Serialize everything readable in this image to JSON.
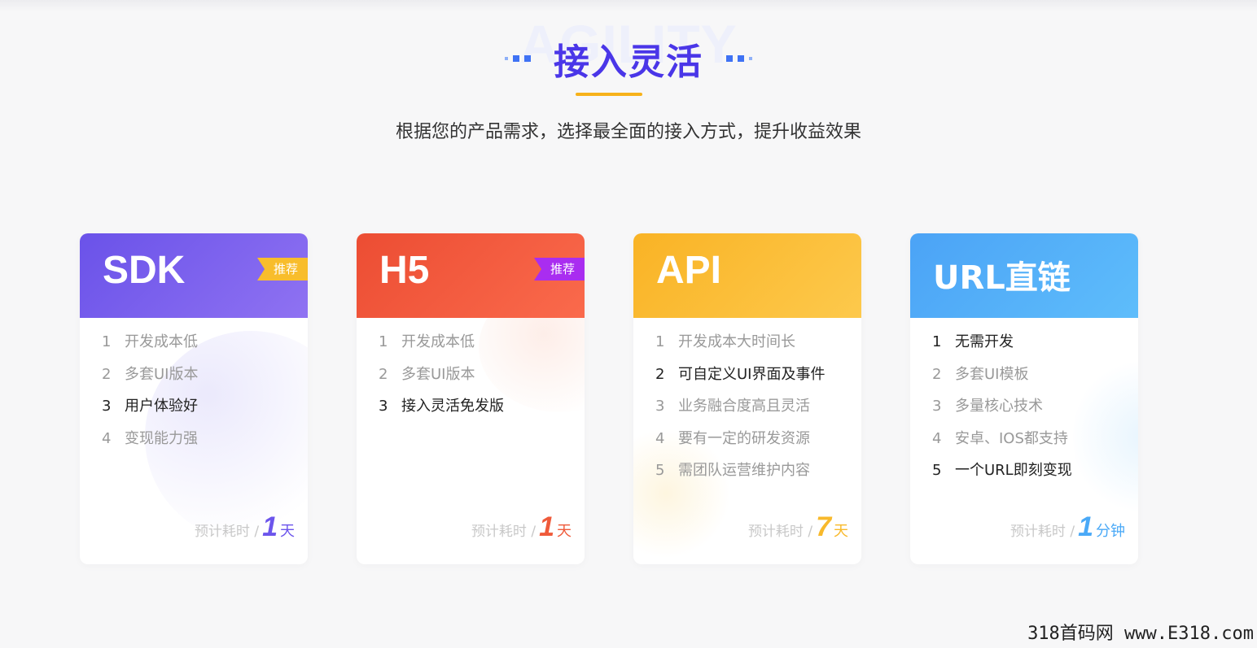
{
  "section": {
    "bg_word": "AGILITY",
    "title": "接入灵活",
    "subtitle": "根据您的产品需求，选择最全面的接入方式，提升收益效果"
  },
  "colors": {
    "title": "#4a36e8",
    "underline": "#f7b21b",
    "dots": "#3f72f4"
  },
  "cards": [
    {
      "name": "SDK",
      "badge": "推荐",
      "features": [
        {
          "n": "1",
          "text": "开发成本低",
          "highlight": false
        },
        {
          "n": "2",
          "text": "多套UI版本",
          "highlight": false
        },
        {
          "n": "3",
          "text": "用户体验好",
          "highlight": true
        },
        {
          "n": "4",
          "text": "变现能力强",
          "highlight": false
        }
      ],
      "est_label": "预计耗时 /",
      "est_value": "1",
      "est_unit": "天",
      "accent": "#6c55ec"
    },
    {
      "name": "H5",
      "badge": "推荐",
      "features": [
        {
          "n": "1",
          "text": "开发成本低",
          "highlight": false
        },
        {
          "n": "2",
          "text": "多套UI版本",
          "highlight": false
        },
        {
          "n": "3",
          "text": "接入灵活免发版",
          "highlight": true
        }
      ],
      "est_label": "预计耗时 /",
      "est_value": "1",
      "est_unit": "天",
      "accent": "#ef5a3a"
    },
    {
      "name": "API",
      "badge": "",
      "features": [
        {
          "n": "1",
          "text": "开发成本大时间长",
          "highlight": false
        },
        {
          "n": "2",
          "text": "可自定义UI界面及事件",
          "highlight": true
        },
        {
          "n": "3",
          "text": "业务融合度高且灵活",
          "highlight": false
        },
        {
          "n": "4",
          "text": "要有一定的研发资源",
          "highlight": false
        },
        {
          "n": "5",
          "text": "需团队运营维护内容",
          "highlight": false
        }
      ],
      "est_label": "预计耗时 /",
      "est_value": "7",
      "est_unit": "天",
      "accent": "#f8b92b"
    },
    {
      "name": "URL直链",
      "badge": "",
      "features": [
        {
          "n": "1",
          "text": "无需开发",
          "highlight": true
        },
        {
          "n": "2",
          "text": "多套UI模板",
          "highlight": false
        },
        {
          "n": "3",
          "text": "多量核心技术",
          "highlight": false
        },
        {
          "n": "4",
          "text": "安卓、IOS都支持",
          "highlight": false
        },
        {
          "n": "5",
          "text": "一个URL即刻变现",
          "highlight": true
        }
      ],
      "est_label": "预计耗时 /",
      "est_value": "1",
      "est_unit": "分钟",
      "accent": "#4aa9f7"
    }
  ],
  "watermark": "318首码网 www.E318.com"
}
